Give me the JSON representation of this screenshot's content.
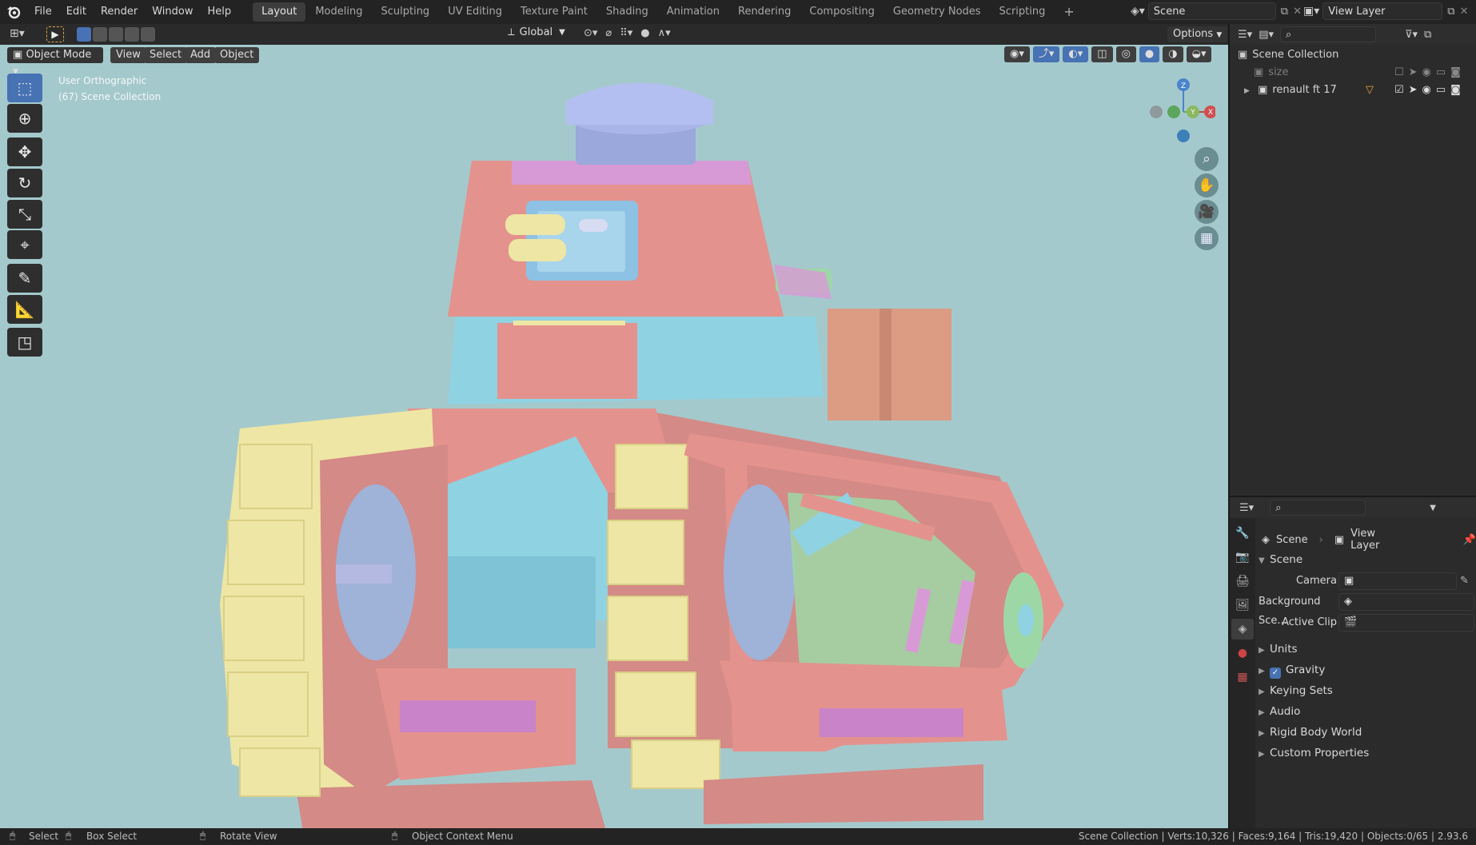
{
  "menu": [
    "File",
    "Edit",
    "Render",
    "Window",
    "Help"
  ],
  "workspaces": [
    "Layout",
    "Modeling",
    "Sculpting",
    "UV Editing",
    "Texture Paint",
    "Shading",
    "Animation",
    "Rendering",
    "Compositing",
    "Geometry Nodes",
    "Scripting"
  ],
  "add_workspace": "+",
  "scene_field": "Scene",
  "view_layer_field": "View Layer",
  "header": {
    "transform_orientation": "Global",
    "options": "Options",
    "mode": "Object Mode",
    "view": "View",
    "select": "Select",
    "add": "Add",
    "object": "Object"
  },
  "viewport": {
    "projection": "User Orthographic",
    "collection_info": "(67) Scene Collection",
    "gizmo_axes": [
      "Z",
      "Y",
      "X"
    ]
  },
  "outliner": {
    "root": "Scene Collection",
    "items": [
      "size",
      "renault ft 17"
    ]
  },
  "properties": {
    "breadcrumb_scene": "Scene",
    "breadcrumb_view_layer": "View Layer",
    "section": "Scene",
    "camera_label": "Camera",
    "background_label": "Background Sce...",
    "active_clip_label": "Active Clip",
    "panels": [
      "Units",
      "Gravity",
      "Keying Sets",
      "Audio",
      "Rigid Body World",
      "Custom Properties"
    ]
  },
  "status": {
    "select": "Select",
    "box_select": "Box Select",
    "rotate_view": "Rotate View",
    "context_menu": "Object Context Menu",
    "stats": "Scene Collection | Verts:10,326 | Faces:9,164 | Tris:19,420 | Objects:0/65 | 2.93.6"
  },
  "colors": {
    "viewport_bg": "#a4c9cc",
    "accent": "#4772b3",
    "tank_red": "#e4928d",
    "tank_blue": "#8fd2e2",
    "tank_yellow": "#eee6a4",
    "tank_green": "#9ed7a6",
    "tank_purple": "#d89ad6"
  }
}
